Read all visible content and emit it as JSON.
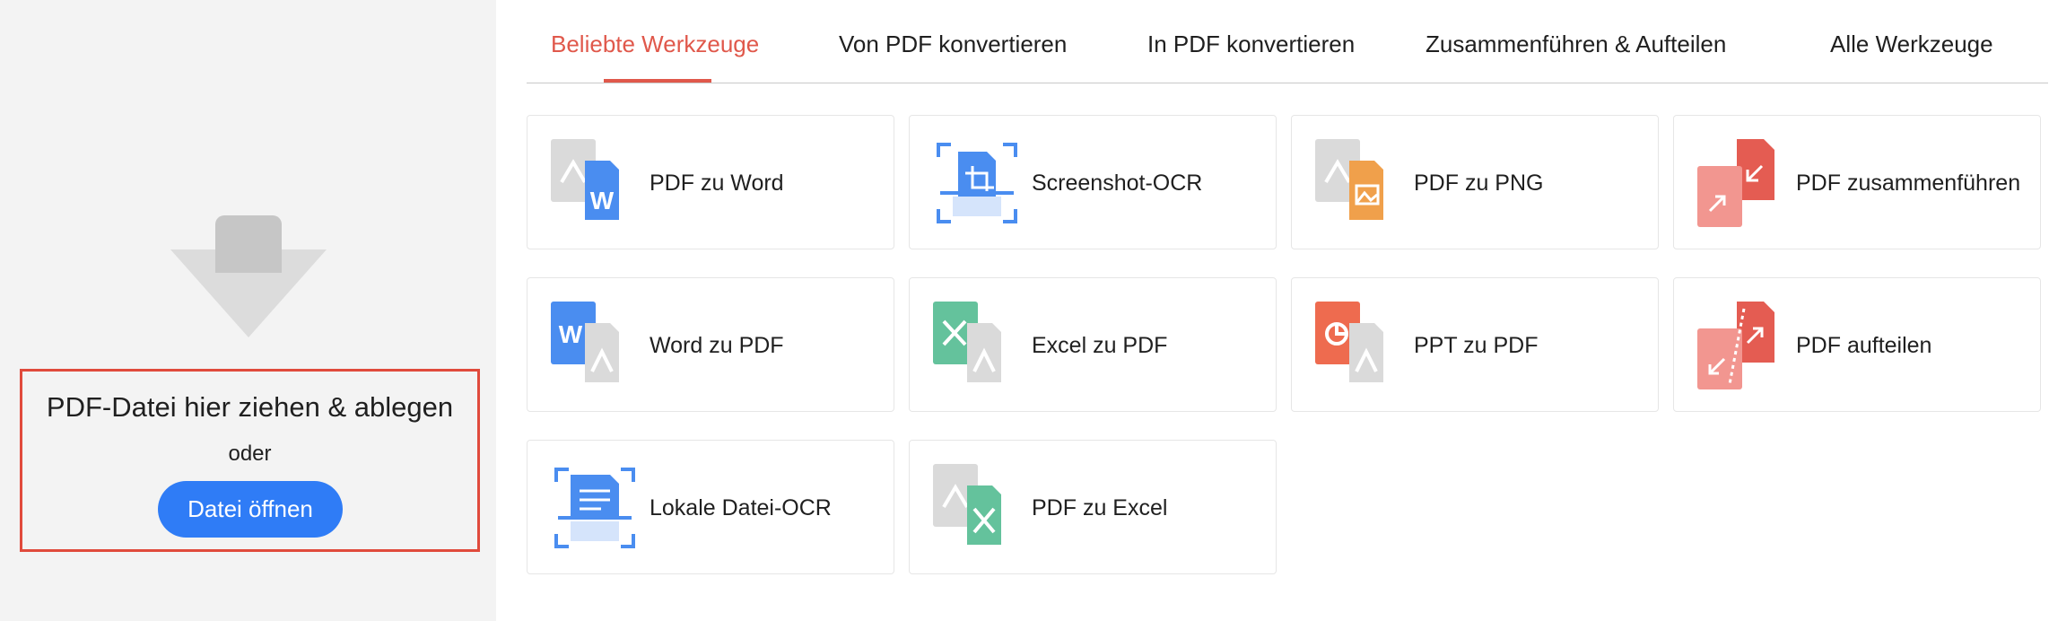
{
  "drop_area": {
    "title": "PDF-Datei hier ziehen & ablegen",
    "or_text": "oder",
    "open_button_label": "Datei öffnen"
  },
  "tabs": [
    {
      "label": "Beliebte Werkzeuge",
      "active": true
    },
    {
      "label": "Von PDF konvertieren",
      "active": false
    },
    {
      "label": "In PDF konvertieren",
      "active": false
    },
    {
      "label": "Zusammenführen & Aufteilen",
      "active": false
    },
    {
      "label": "Alle Werkzeuge",
      "active": false
    }
  ],
  "tools": [
    {
      "label": "PDF zu Word",
      "icon": "pdf-to-word-icon"
    },
    {
      "label": "Screenshot-OCR",
      "icon": "screenshot-ocr-icon"
    },
    {
      "label": "PDF zu PNG",
      "icon": "pdf-to-png-icon"
    },
    {
      "label": "PDF zusammenführen",
      "icon": "merge-pdf-icon"
    },
    {
      "label": "Word zu PDF",
      "icon": "word-to-pdf-icon"
    },
    {
      "label": "Excel zu PDF",
      "icon": "excel-to-pdf-icon"
    },
    {
      "label": "PPT zu PDF",
      "icon": "ppt-to-pdf-icon"
    },
    {
      "label": "PDF aufteilen",
      "icon": "split-pdf-icon"
    },
    {
      "label": "Lokale Datei-OCR",
      "icon": "local-file-ocr-icon"
    },
    {
      "label": "PDF zu Excel",
      "icon": "pdf-to-excel-icon"
    }
  ],
  "colors": {
    "accent": "#e0584b",
    "button": "#2f7cf6",
    "drop_border": "#e04a3c",
    "word": "#4a8df0",
    "excel": "#64c29c",
    "ppt": "#ee6b4f",
    "png": "#f0a04b",
    "merge": "#e45c52"
  }
}
